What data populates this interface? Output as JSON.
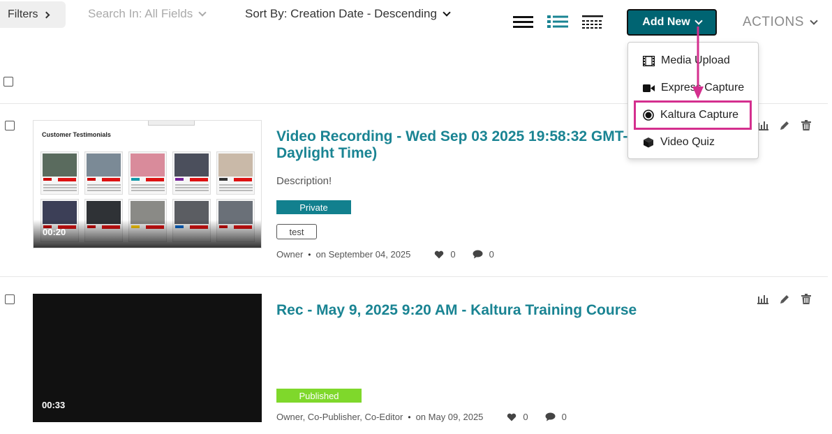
{
  "toolbar": {
    "filters_label": "Filters",
    "search_in_label": "Search In: All Fields",
    "sort_by_label": "Sort By: Creation Date - Descending",
    "add_new_label": "Add New",
    "actions_label": "ACTIONS",
    "view_modes": [
      "list-icon",
      "detailed-list-icon",
      "compact-list-icon"
    ]
  },
  "add_new_menu": {
    "items": [
      {
        "label": "Media Upload",
        "icon": "film-icon"
      },
      {
        "label": "Express Capture",
        "icon": "video-camera-icon"
      },
      {
        "label": "Kaltura Capture",
        "icon": "record-icon"
      },
      {
        "label": "Video Quiz",
        "icon": "cube-icon"
      }
    ],
    "highlighted_item": "Kaltura Capture",
    "highlight_color": "#d42f8e"
  },
  "entries": [
    {
      "title_line1": "Video Recording - Wed Sep 03 2025 19:58:32 GMT-0",
      "title_line2": "Daylight Time)",
      "description": "Description!",
      "status": "Private",
      "tag": "test",
      "owner": "Owner",
      "date": "on September 04, 2025",
      "likes": "0",
      "comments": "0",
      "duration": "00:20",
      "thumbnail_title": "Customer Testimonials"
    },
    {
      "title_line1": "Rec - May 9, 2025 9:20 AM - Kaltura Training Course",
      "status": "Published",
      "owner": "Owner, Co-Publisher, Co-Editor",
      "date": "on May 09, 2025",
      "likes": "0",
      "comments": "0",
      "duration": "00:33"
    }
  ],
  "colors": {
    "accent": "#006472",
    "link": "#1a8493",
    "private_badge": "#12808e",
    "published_badge": "#7fd82b"
  }
}
